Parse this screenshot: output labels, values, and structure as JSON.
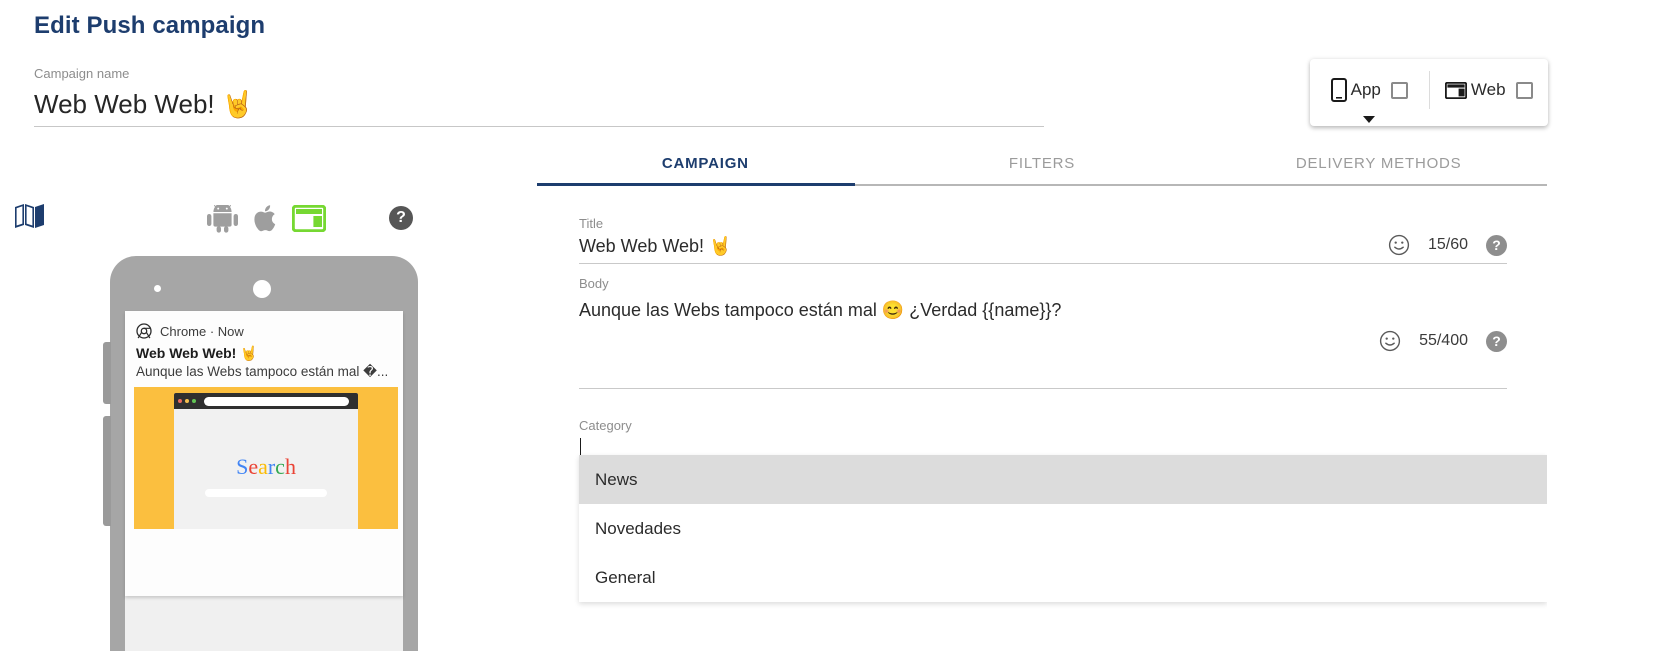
{
  "header": {
    "page_title": "Edit Push campaign",
    "campaign_name_label": "Campaign name",
    "campaign_name_value": "Web Web Web! 🤘"
  },
  "platform_card": {
    "app": {
      "label": "App",
      "icon": "mobile-phone-icon",
      "checked": false
    },
    "web": {
      "label": "Web",
      "icon": "browser-window-icon",
      "checked": false
    },
    "caret": "caret-down-icon"
  },
  "tabs": [
    {
      "label": "CAMPAIGN",
      "active": true
    },
    {
      "label": "FILTERS",
      "active": false
    },
    {
      "label": "DELIVERY METHODS",
      "active": false
    }
  ],
  "form": {
    "title": {
      "label": "Title",
      "value": "Web Web Web! 🤘",
      "counter": "15/60",
      "emoji_icon": "emoji-smiley-icon",
      "help_icon": "help-question-icon",
      "help_glyph": "?"
    },
    "body": {
      "label": "Body",
      "value": "Aunque las Webs tampoco están mal 😊  ¿Verdad {{name}}?",
      "counter": "55/400",
      "emoji_icon": "emoji-smiley-icon",
      "help_icon": "help-question-icon",
      "help_glyph": "?"
    },
    "category": {
      "label": "Category",
      "value": "",
      "options": [
        {
          "label": "News",
          "highlighted": true
        },
        {
          "label": "Novedades",
          "highlighted": false
        },
        {
          "label": "General",
          "highlighted": false
        }
      ]
    }
  },
  "preview": {
    "map_icon": "map-book-icon",
    "platform_icons": [
      {
        "name": "android-icon",
        "active": false,
        "color": "#9e9e9e"
      },
      {
        "name": "apple-icon",
        "active": false,
        "color": "#9e9e9e"
      },
      {
        "name": "web-browser-icon",
        "active": true,
        "color": "#76d832"
      }
    ],
    "help_glyph": "?",
    "notification": {
      "source": "Chrome · Now",
      "app_icon": "chrome-icon",
      "title": "Web Web Web! 🤘",
      "body": "Aunque las Webs tampoco están mal �...",
      "image": {
        "background_color": "#fbbf3f",
        "search_letters": [
          {
            "ch": "S",
            "color": "#4285f4"
          },
          {
            "ch": "e",
            "color": "#ea4335"
          },
          {
            "ch": "a",
            "color": "#fbbc05"
          },
          {
            "ch": "r",
            "color": "#4285f4"
          },
          {
            "ch": "c",
            "color": "#34a853"
          },
          {
            "ch": "h",
            "color": "#ea4335"
          }
        ]
      }
    }
  },
  "colors": {
    "brand_navy": "#1d3d6e",
    "accent_green": "#76d832",
    "amber": "#fbbf3f",
    "muted_gray": "#8d8d8d"
  }
}
